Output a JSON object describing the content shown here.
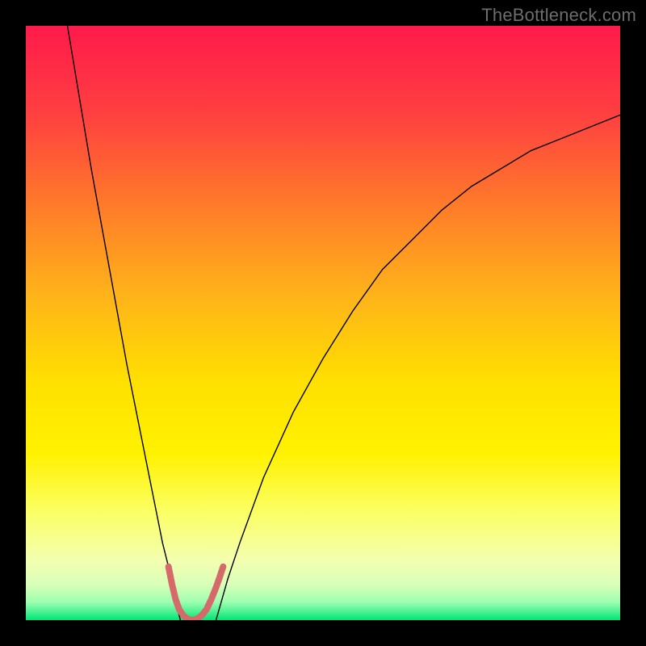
{
  "watermark": "TheBottleneck.com",
  "chart_data": {
    "type": "line",
    "title": "",
    "xlabel": "",
    "ylabel": "",
    "xlim": [
      0,
      100
    ],
    "ylim": [
      0,
      100
    ],
    "grid": false,
    "legend": false,
    "background_gradient": {
      "stops": [
        {
          "offset": 0.0,
          "color": "#ff1a4b"
        },
        {
          "offset": 0.15,
          "color": "#ff4040"
        },
        {
          "offset": 0.3,
          "color": "#ff7a2a"
        },
        {
          "offset": 0.45,
          "color": "#ffb21a"
        },
        {
          "offset": 0.6,
          "color": "#ffe000"
        },
        {
          "offset": 0.72,
          "color": "#fff200"
        },
        {
          "offset": 0.82,
          "color": "#fbff66"
        },
        {
          "offset": 0.9,
          "color": "#f3ffb0"
        },
        {
          "offset": 0.94,
          "color": "#d9ffb8"
        },
        {
          "offset": 0.97,
          "color": "#9cffb0"
        },
        {
          "offset": 1.0,
          "color": "#00e676"
        }
      ]
    },
    "series": [
      {
        "name": "curve-left",
        "color": "#000000",
        "width": 1.4,
        "x": [
          7,
          9,
          11,
          13,
          15,
          17,
          19,
          20,
          21,
          22,
          23,
          24,
          25,
          26
        ],
        "y": [
          100,
          88,
          76,
          65,
          54,
          43,
          33,
          28,
          23,
          18,
          13,
          9,
          4,
          0
        ]
      },
      {
        "name": "curve-right",
        "color": "#000000",
        "width": 1.4,
        "x": [
          32,
          34,
          36,
          40,
          45,
          50,
          55,
          60,
          65,
          70,
          75,
          80,
          85,
          90,
          95,
          100
        ],
        "y": [
          0,
          7,
          13,
          24,
          35,
          44,
          52,
          59,
          64,
          69,
          73,
          76,
          79,
          81,
          83,
          85
        ]
      },
      {
        "name": "highlight-band",
        "color": "#d66a6a",
        "width": 8,
        "linecap": "round",
        "x": [
          24.0,
          24.6,
          25.2,
          25.8,
          26.5,
          27.2,
          28.0,
          28.8,
          29.6,
          30.4,
          31.2,
          32.0,
          32.6,
          33.2
        ],
        "y": [
          9.0,
          6.0,
          3.5,
          1.8,
          0.8,
          0.2,
          0.0,
          0.2,
          0.8,
          1.8,
          3.5,
          5.5,
          7.2,
          9.0
        ]
      }
    ]
  }
}
